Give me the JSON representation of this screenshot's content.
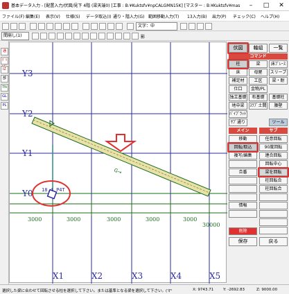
{
  "title_bar": {
    "title": "基本データ入力 - [配置入力/伏図/見下 4階 (梁天端0) [工事 : B:¥Kuktsfv¥npCALGMN15K] [マスター : B:¥Kuktsfv¥master¥] [Ver4.3(1)] ]",
    "minimize": "–",
    "maximize": "□",
    "close": "✕"
  },
  "menu": [
    "ファイル(F)",
    "編集(E)",
    "表示(V)",
    "仕様(S)",
    "データ取込(I)",
    "通り・階入力(G)",
    "範囲移動入力(T)",
    "13入力(B)",
    "出力(P)",
    "チェック(C)",
    "ヘルプ(H)"
  ],
  "toolbar": {
    "font_select": "文字：中",
    "shadow_label": "影"
  },
  "subbar": {
    "combo_value": "間崩し(1)"
  },
  "left_tools": [
    "通",
    "ｸﾞﾘｯﾄﾞ",
    "IZ",
    "部",
    "TN",
    "GL",
    "PL"
  ],
  "canvas": {
    "grid_rows": [
      "Y3",
      "Y2",
      "Y1",
      "Y0"
    ],
    "grid_cols": [
      "X1",
      "X2",
      "X3",
      "X4",
      "X5"
    ],
    "dims": [
      "3000",
      "3000",
      "3000",
      "3000",
      "3000"
    ],
    "total_dim": "30000",
    "beam_label": "18.4  P4T",
    "beam_mark": "G→"
  },
  "panel": {
    "top_buttons": [
      "伏図",
      "軸組",
      "一覧"
    ],
    "section_command": "コマンド",
    "commands": [
      [
        "柱",
        "梁",
        "床ﾌﾞﾚｰｽ"
      ],
      [
        "床",
        "母屋",
        "スリーブ"
      ],
      [
        "補足材",
        "工区",
        "梁・耐"
      ],
      [
        "仕口",
        "金物/PL",
        ""
      ],
      [
        "独立基礎",
        "布基礎",
        "基礎柱"
      ],
      [
        "地中梁",
        "ｽﾗﾌﾞ土間",
        "腰壁"
      ],
      [
        "ﾊﾞｲﾌﾞﾗｯﾄﾞ",
        "",
        ""
      ],
      [
        "ｻﾌﾞ通り",
        "",
        "ツール"
      ]
    ],
    "section_main": "メイン",
    "section_sub": "サブ",
    "main_buttons": [
      "移動",
      "回転/取込",
      "複写/編集",
      "",
      "合番",
      "",
      "",
      "",
      "情報"
    ],
    "sub_buttons": [
      "任意回転",
      "90度回転",
      "連合回転",
      "回転中心",
      "梁を回転",
      "柱回転合",
      "柱回転合"
    ],
    "delete_button": "削除",
    "save_button": "保存",
    "back_button": "戻る"
  },
  "status": {
    "message": "選択した梁に合わせて回転させる柱を選択して下さい。または基準となる梁を選択して下さい。(マウス)",
    "x": "X: 9743.71",
    "y": "Y: -2692.83",
    "z": "Z: 9000.00"
  },
  "colors": {
    "grid": "#2a2aa0",
    "dim": "#1a6b1a",
    "beam_fill": "#e8e2a8",
    "highlight": "#e03030",
    "panel_header": "#d84a40"
  }
}
